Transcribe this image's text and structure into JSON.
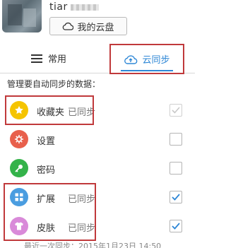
{
  "user": {
    "name": "tiar"
  },
  "cloud_button": {
    "label": "我的云盘"
  },
  "tabs": [
    {
      "label": "常用"
    },
    {
      "label": "云同步"
    }
  ],
  "section_title": "管理要自动同步的数据：",
  "items": [
    {
      "label": "收藏夹",
      "status": "已同步",
      "icon": "star-icon",
      "color": "#f5c400",
      "checked": true,
      "disabled": true
    },
    {
      "label": "设置",
      "status": "",
      "icon": "gear-icon",
      "color": "#e8604c",
      "checked": false,
      "disabled": false
    },
    {
      "label": "密码",
      "status": "",
      "icon": "key-icon",
      "color": "#34b34a",
      "checked": false,
      "disabled": false
    },
    {
      "label": "扩展",
      "status": "已同步",
      "icon": "grid-icon",
      "color": "#4a9de0",
      "checked": true,
      "disabled": false
    },
    {
      "label": "皮肤",
      "status": "已同步",
      "icon": "shirt-icon",
      "color": "#d98ad9",
      "checked": true,
      "disabled": false
    }
  ],
  "footer": {
    "last_sync": "最近一次同步：2015年1月23日 14:50"
  },
  "colors": {
    "accent": "#2e87d6",
    "highlight": "#c0393b"
  }
}
